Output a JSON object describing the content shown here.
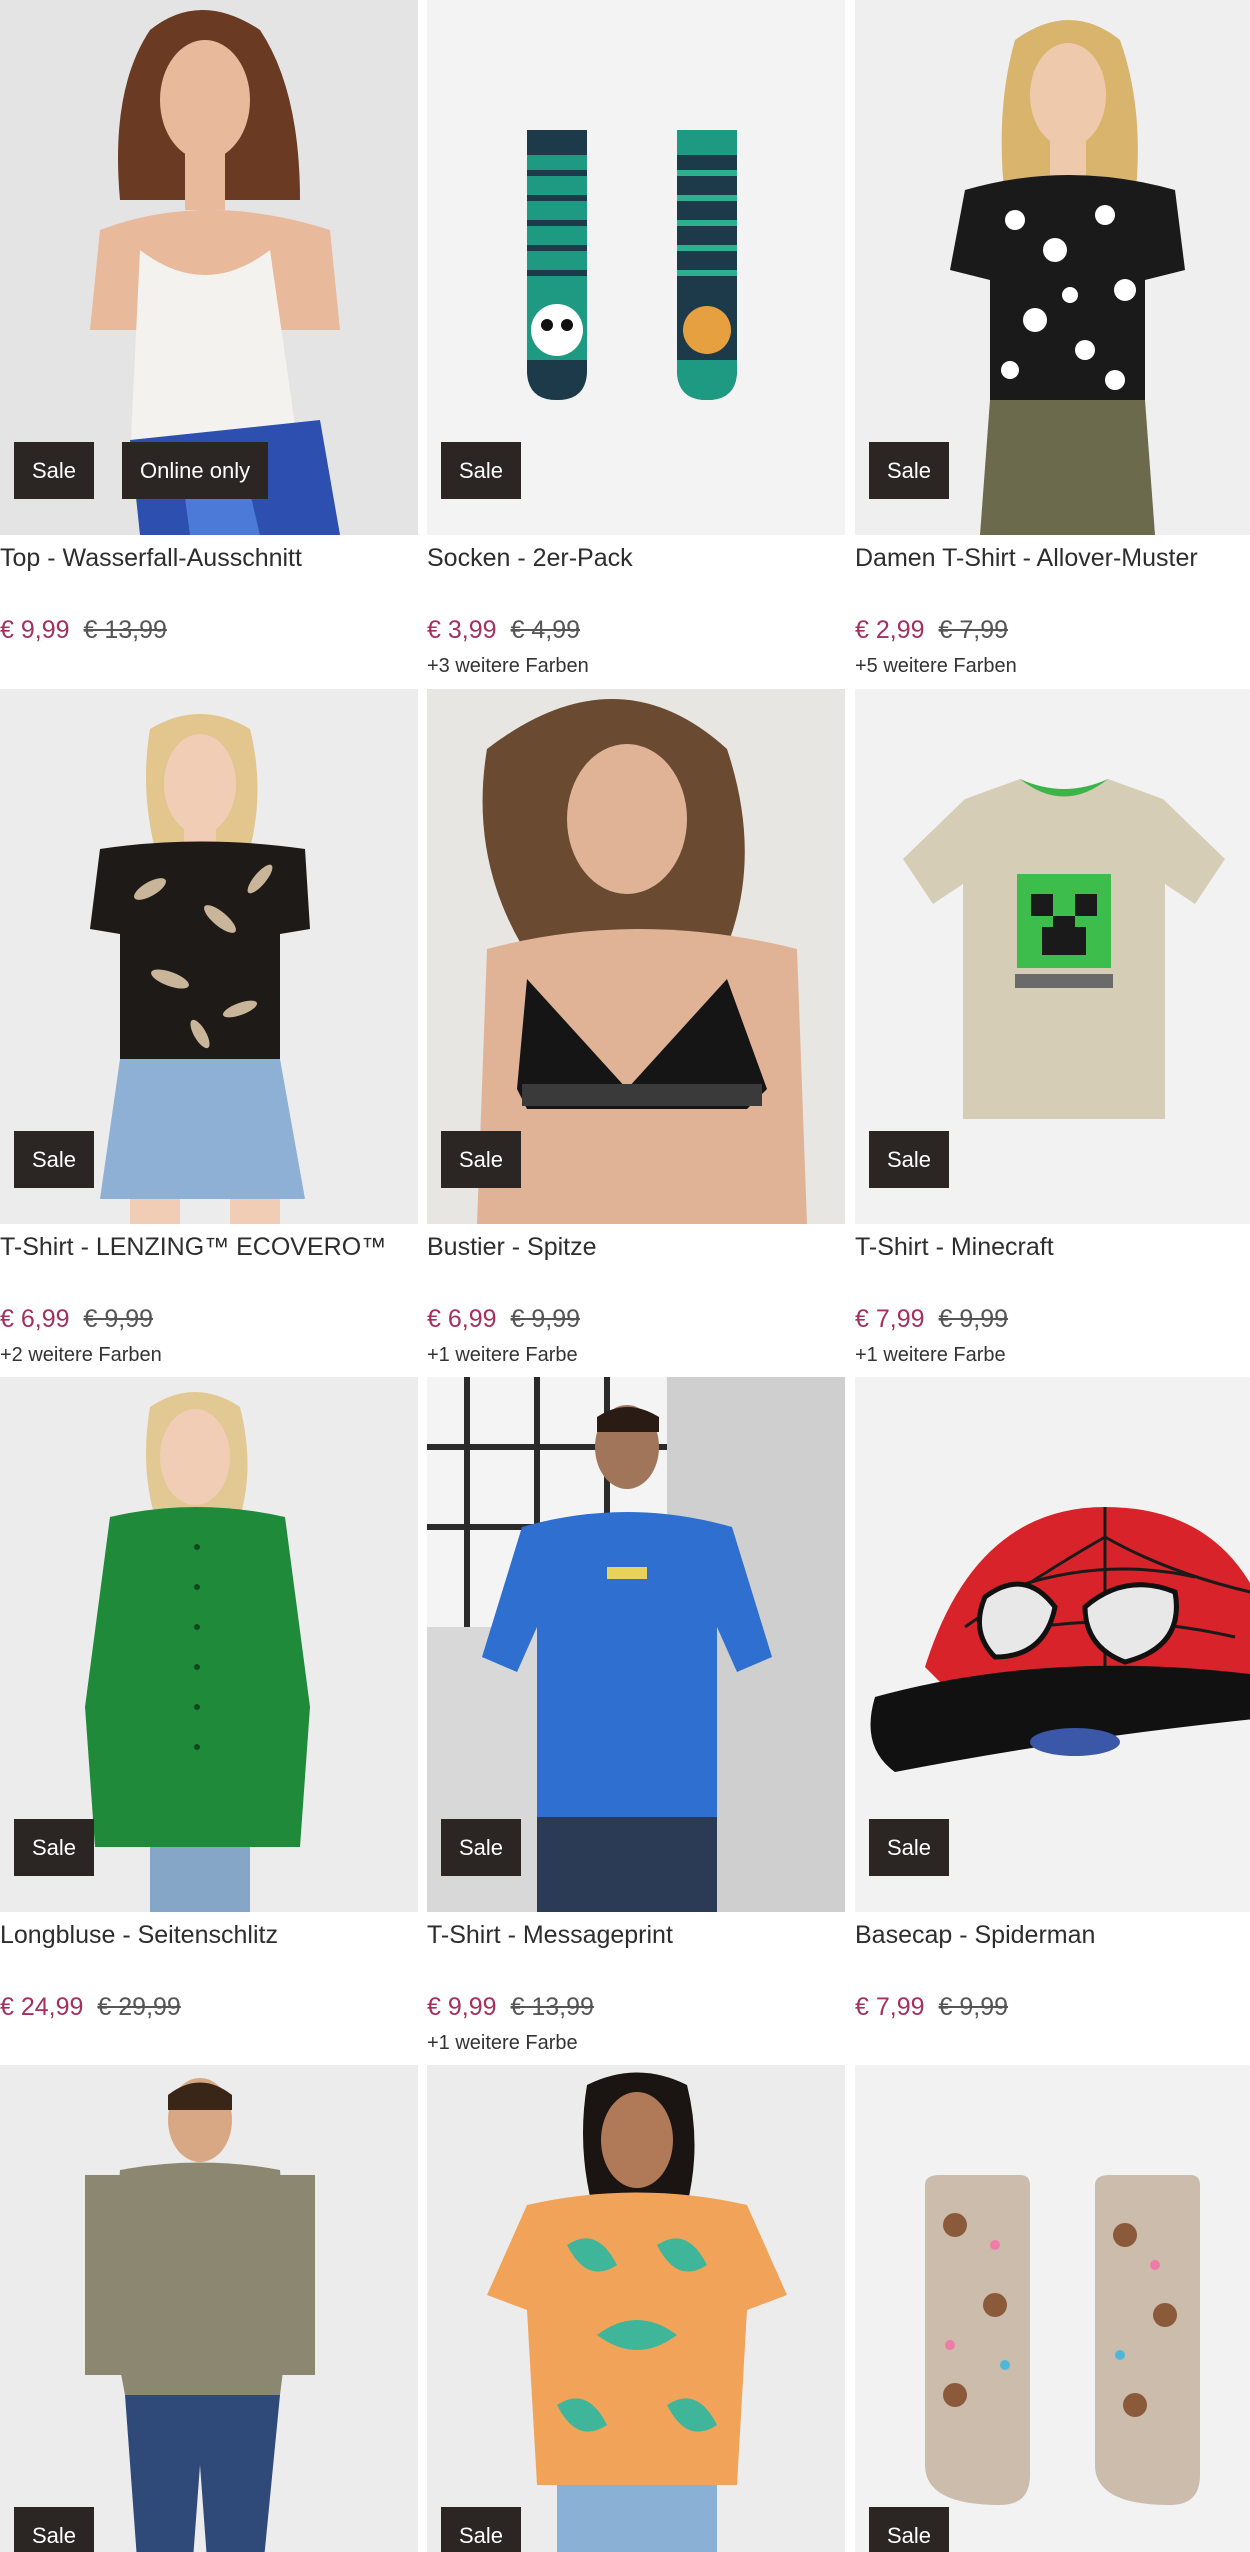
{
  "products": [
    {
      "title": "Top - Wasserfall-Ausschnitt",
      "price": "€ 9,99",
      "old_price": "€ 13,99",
      "badges": [
        "Sale",
        "Online only"
      ],
      "colors": "",
      "image": "woman-white-cami-top-photo"
    },
    {
      "title": "Socken - 2er-Pack",
      "price": "€ 3,99",
      "old_price": "€ 4,99",
      "badges": [
        "Sale"
      ],
      "colors": "+3 weitere Farben",
      "image": "striped-socks-panda-tiger-photo"
    },
    {
      "title": "Damen T-Shirt - Allover-Muster",
      "price": "€ 2,99",
      "old_price": "€ 7,99",
      "badges": [
        "Sale"
      ],
      "colors": "+5 weitere Farben",
      "image": "woman-leopard-tshirt-photo"
    },
    {
      "title": "T-Shirt - LENZING™ ECOVERO™",
      "price": "€ 6,99",
      "old_price": "€ 9,99",
      "badges": [
        "Sale"
      ],
      "colors": "+2 weitere Farben",
      "image": "woman-leaf-print-shirt-photo"
    },
    {
      "title": "Bustier - Spitze",
      "price": "€ 6,99",
      "old_price": "€ 9,99",
      "badges": [
        "Sale"
      ],
      "colors": "+1 weitere Farbe",
      "image": "woman-black-lace-bralette-photo"
    },
    {
      "title": "T-Shirt - Minecraft",
      "price": "€ 7,99",
      "old_price": "€ 9,99",
      "badges": [
        "Sale"
      ],
      "colors": "+1 weitere Farbe",
      "image": "minecraft-creeper-tshirt-photo"
    },
    {
      "title": "Longbluse - Seitenschlitz",
      "price": "€ 24,99",
      "old_price": "€ 29,99",
      "badges": [
        "Sale"
      ],
      "colors": "",
      "image": "woman-green-long-blouse-photo"
    },
    {
      "title": "T-Shirt - Messageprint",
      "price": "€ 9,99",
      "old_price": "€ 13,99",
      "badges": [
        "Sale"
      ],
      "colors": "+1 weitere Farbe",
      "image": "man-blue-tshirt-photo"
    },
    {
      "title": "Basecap - Spiderman",
      "price": "€ 7,99",
      "old_price": "€ 9,99",
      "badges": [
        "Sale"
      ],
      "colors": "",
      "image": "spiderman-red-cap-photo"
    },
    {
      "title": "",
      "price": "",
      "old_price": "",
      "badges": [
        "Sale"
      ],
      "colors": "",
      "image": "man-olive-sweater-jeans-photo"
    },
    {
      "title": "",
      "price": "",
      "old_price": "",
      "badges": [
        "Sale"
      ],
      "colors": "",
      "image": "woman-orange-pattern-shirt-photo"
    },
    {
      "title": "",
      "price": "",
      "old_price": "",
      "badges": [
        "Sale"
      ],
      "colors": "",
      "image": "dog-print-socks-photo"
    }
  ],
  "colors": {
    "sale_price": "#a3305e",
    "badge_bg": "#2b2523",
    "badge_text": "#ffffff"
  }
}
